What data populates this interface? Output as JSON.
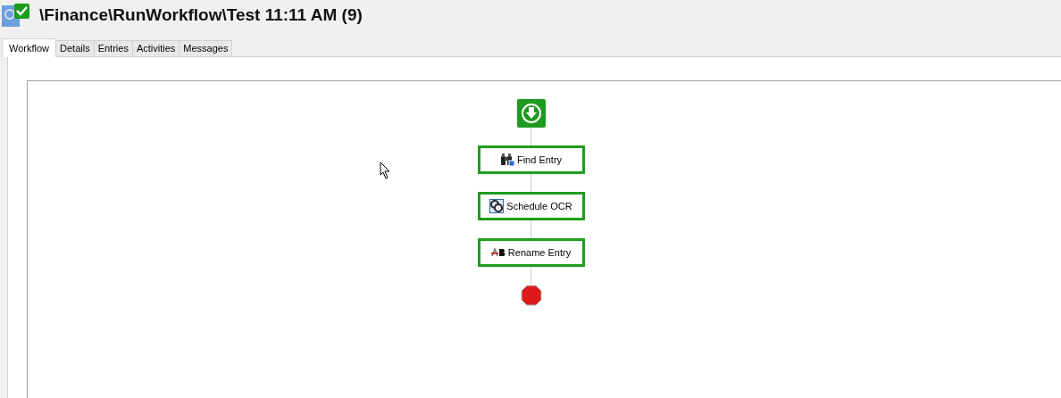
{
  "window": {
    "title": "\\Finance\\RunWorkflow\\Test 11:11 AM (9)"
  },
  "tabs": [
    {
      "label": "Workflow",
      "selected": true
    },
    {
      "label": "Details",
      "selected": false
    },
    {
      "label": "Entries",
      "selected": false
    },
    {
      "label": "Activities",
      "selected": false
    },
    {
      "label": "Messages",
      "selected": false
    }
  ],
  "workflow": {
    "steps": [
      {
        "kind": "find",
        "label": "Find Entry"
      },
      {
        "kind": "ocr",
        "label": "Schedule OCR"
      },
      {
        "kind": "rename",
        "label": "Rename Entry"
      }
    ]
  }
}
